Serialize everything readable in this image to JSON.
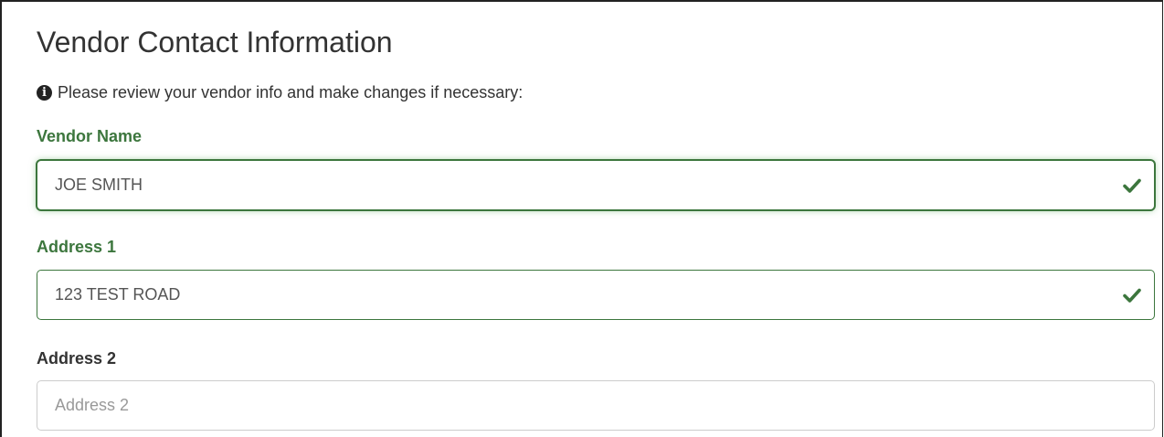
{
  "page": {
    "title": "Vendor Contact Information",
    "notice": "Please review your vendor info and make changes if necessary:"
  },
  "form": {
    "vendor_name": {
      "label": "Vendor Name",
      "value": "JOE SMITH",
      "state": "success",
      "icon": "check-icon"
    },
    "address1": {
      "label": "Address 1",
      "value": "123 TEST ROAD",
      "state": "success",
      "icon": "check-icon"
    },
    "address2": {
      "label": "Address 2",
      "value": "",
      "placeholder": "Address 2",
      "state": "default"
    }
  },
  "colors": {
    "success": "#3c763d",
    "text": "#333333",
    "input_border": "#cccccc",
    "placeholder": "#999999"
  },
  "icons": {
    "notice": "info-circle-icon",
    "valid": "check-icon"
  }
}
